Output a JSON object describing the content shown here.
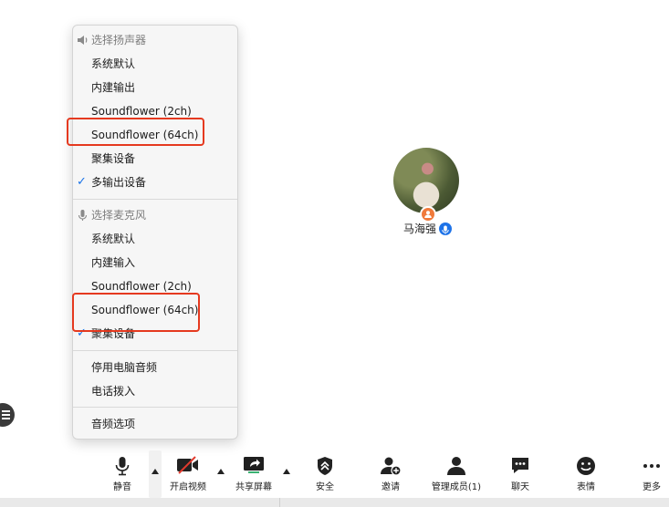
{
  "menu": {
    "speaker_header": "选择扬声器",
    "speaker_items": [
      {
        "label": "系统默认",
        "checked": false
      },
      {
        "label": "内建输出",
        "checked": false
      },
      {
        "label": "Soundflower (2ch)",
        "checked": false
      },
      {
        "label": "Soundflower (64ch)",
        "checked": false
      },
      {
        "label": "聚集设备",
        "checked": false
      },
      {
        "label": "多输出设备",
        "checked": true
      }
    ],
    "mic_header": "选择麦克风",
    "mic_items": [
      {
        "label": "系统默认",
        "checked": false
      },
      {
        "label": "内建输入",
        "checked": false
      },
      {
        "label": "Soundflower (2ch)",
        "checked": false
      },
      {
        "label": "Soundflower (64ch)",
        "checked": false
      },
      {
        "label": "聚集设备",
        "checked": true
      }
    ],
    "extra_items": [
      {
        "label": "停用电脑音频"
      },
      {
        "label": "电话拨入"
      }
    ],
    "audio_options": "音频选项",
    "highlight_color": "#e5391f",
    "check_color": "#1a73e8"
  },
  "participant": {
    "name": "马海强"
  },
  "toolbar": {
    "items": [
      {
        "key": "mute",
        "label": "静音",
        "icon": "microphone-icon"
      },
      {
        "key": "video",
        "label": "开启视频",
        "icon": "video-off-icon"
      },
      {
        "key": "share",
        "label": "共享屏幕",
        "icon": "share-screen-icon"
      },
      {
        "key": "security",
        "label": "安全",
        "icon": "shield-icon"
      },
      {
        "key": "invite",
        "label": "邀请",
        "icon": "add-user-icon"
      },
      {
        "key": "participants",
        "label": "管理成员(1)",
        "icon": "people-icon"
      },
      {
        "key": "chat",
        "label": "聊天",
        "icon": "chat-icon"
      },
      {
        "key": "reactions",
        "label": "表情",
        "icon": "smiley-icon"
      },
      {
        "key": "more",
        "label": "更多",
        "icon": "more-icon"
      }
    ]
  }
}
